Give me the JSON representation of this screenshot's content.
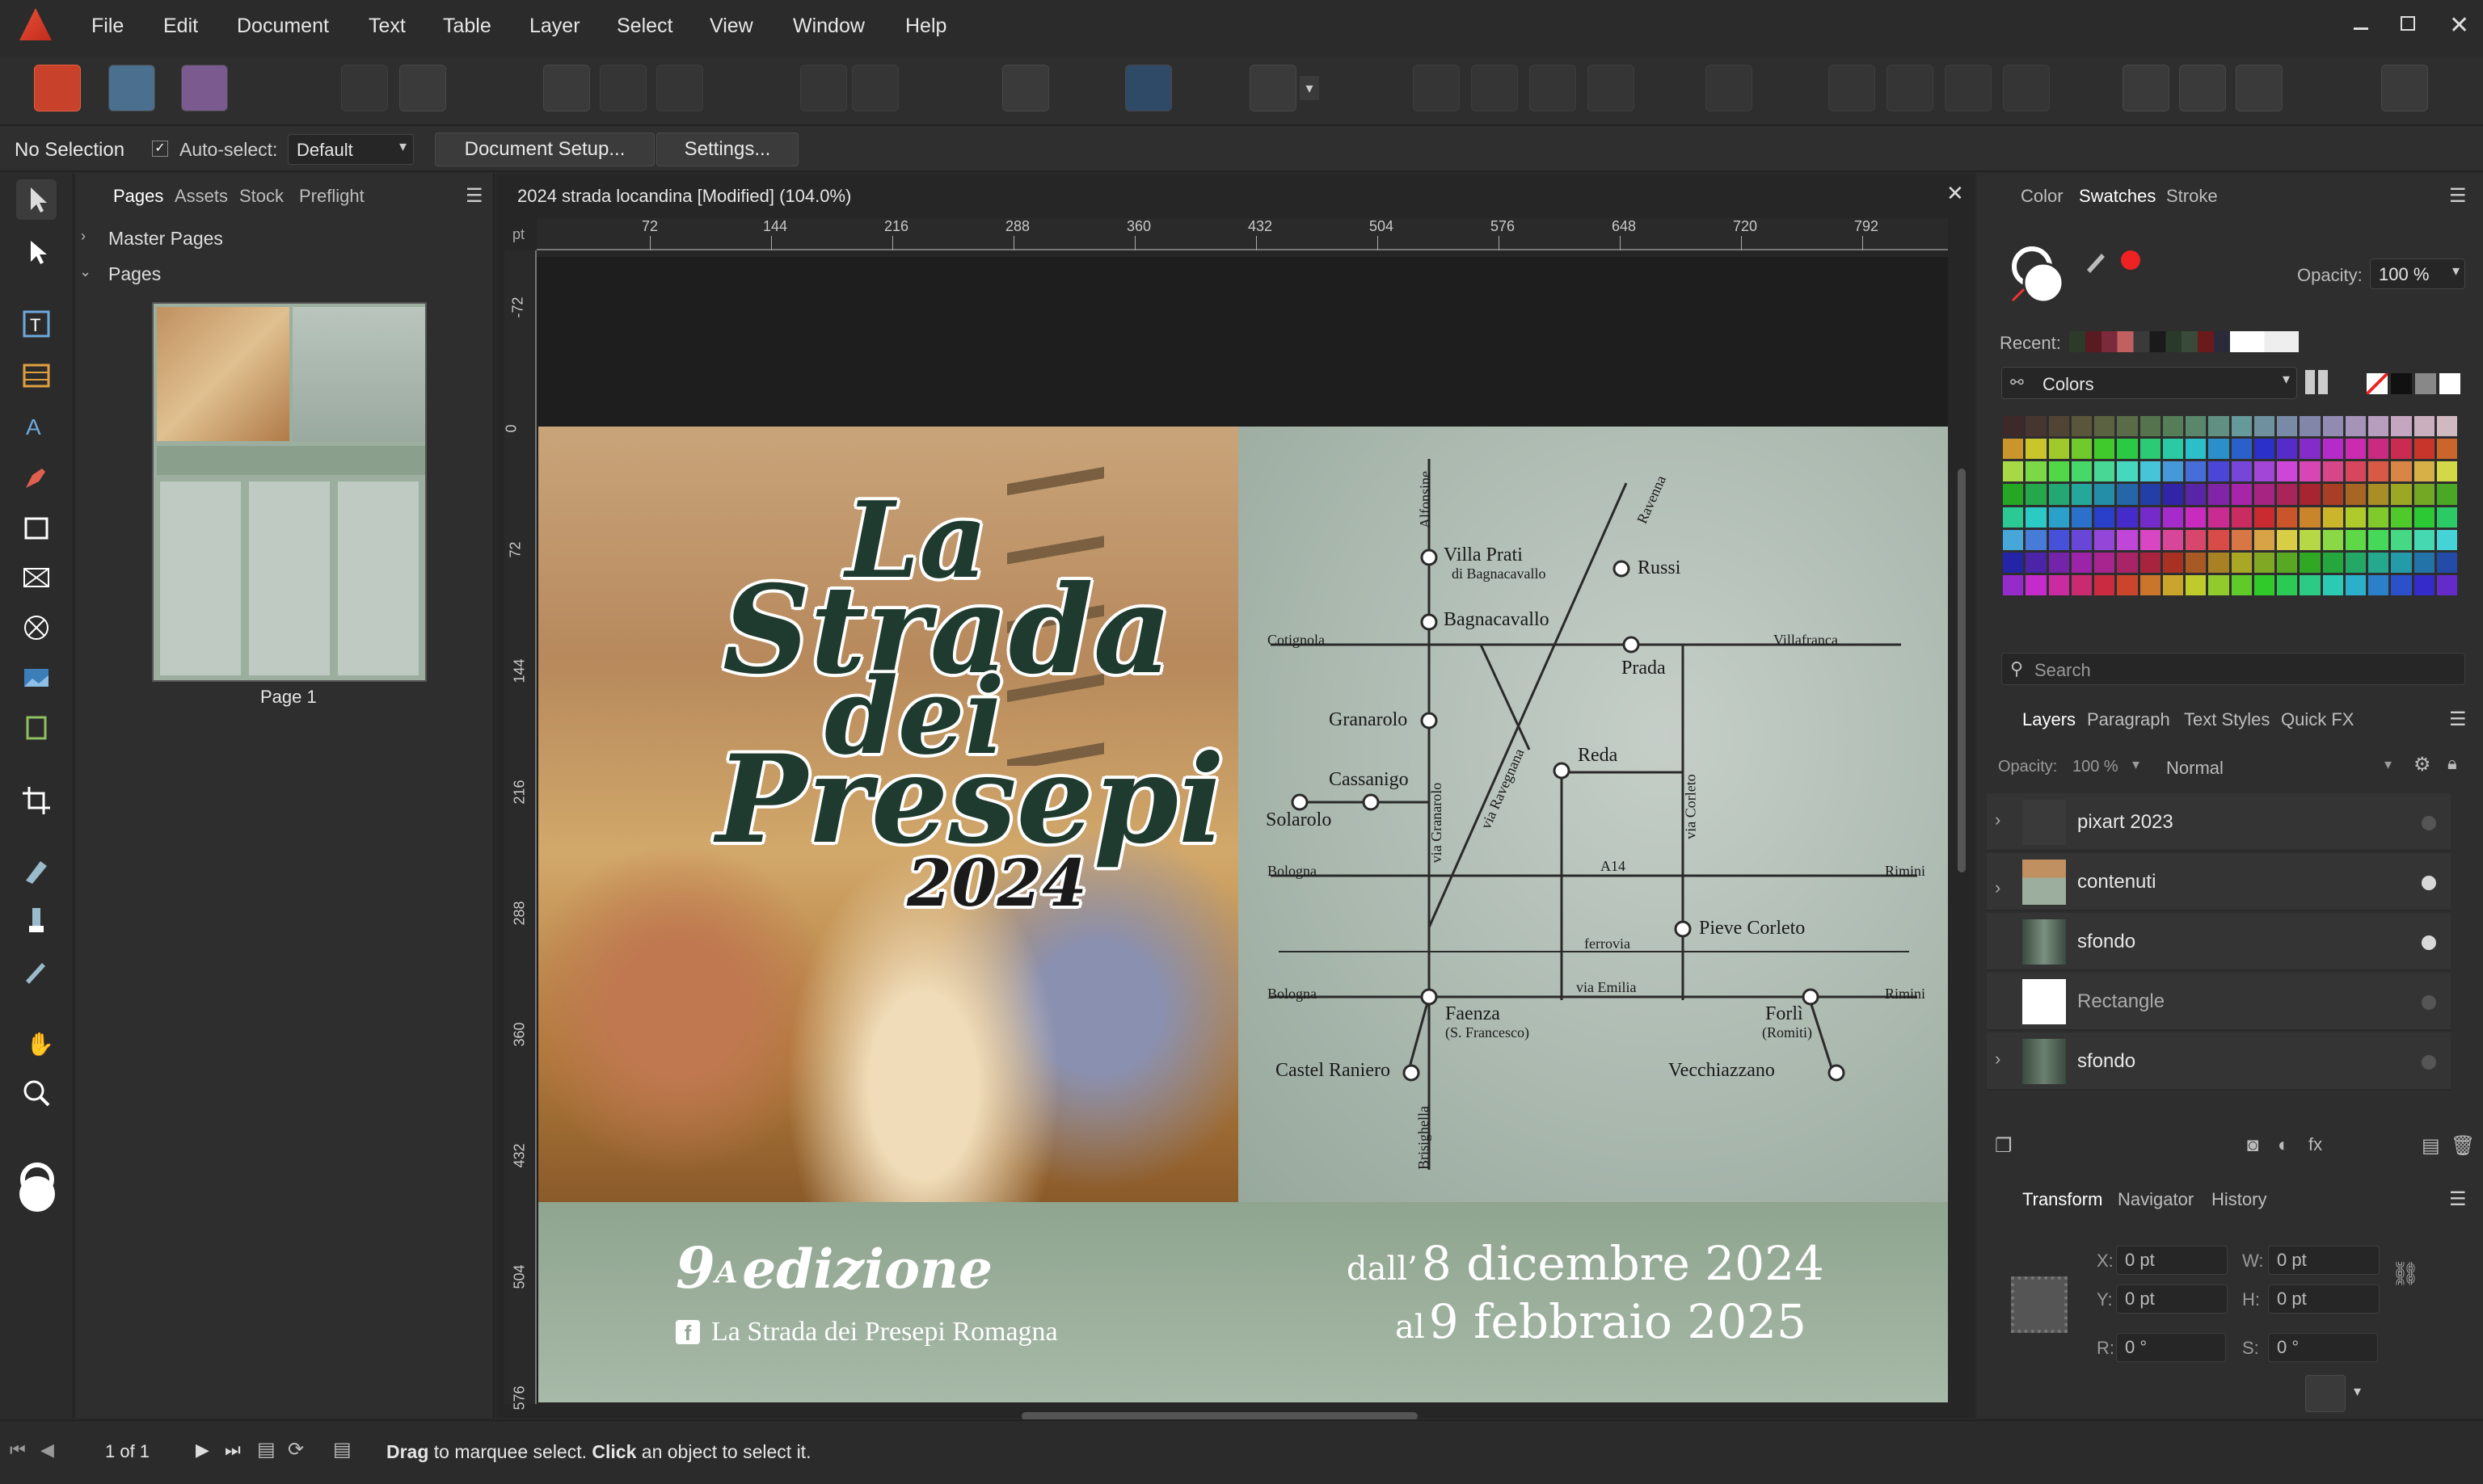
{
  "menu": [
    "File",
    "Edit",
    "Document",
    "Text",
    "Table",
    "Layer",
    "Select",
    "View",
    "Window",
    "Help"
  ],
  "context": {
    "selection": "No Selection",
    "autoselect_label": "Auto-select:",
    "autoselect_value": "Default",
    "doc_setup": "Document Setup...",
    "settings": "Settings..."
  },
  "pages_panel": {
    "tabs": [
      "Pages",
      "Assets",
      "Stock",
      "Preflight"
    ],
    "master_pages": "Master Pages",
    "pages": "Pages",
    "page_label": "Page 1"
  },
  "document": {
    "tab_title": "2024 strada locandina [Modified] (104.0%)",
    "ruler_unit": "pt",
    "h_ticks": [
      "72",
      "144",
      "216",
      "288",
      "360",
      "432",
      "504",
      "576",
      "648",
      "720",
      "792"
    ],
    "v_ticks": [
      "-72",
      "0",
      "72",
      "144",
      "216",
      "288",
      "360",
      "432",
      "504",
      "576"
    ]
  },
  "poster": {
    "title": [
      "La",
      "Strada",
      "dei",
      "Presepi"
    ],
    "year": "2024",
    "edition_num": "9",
    "edition_sup": "A",
    "edition_word": "edizione",
    "facebook": "La Strada dei Presepi Romagna",
    "date_from_prefix": "dall’",
    "date_from": "8 dicembre 2024",
    "date_to_prefix": "al",
    "date_to": "9 febbraio 2025",
    "map": {
      "towns": [
        "Villa Prati",
        "di Bagnacavallo",
        "Russi",
        "Bagnacavallo",
        "Prada",
        "Granarolo",
        "Reda",
        "Cassanigo",
        "Solarolo",
        "Pieve Corleto",
        "Faenza",
        "(S. Francesco)",
        "Forlì",
        "(Romiti)",
        "Castel Raniero",
        "Vecchiazzano"
      ],
      "roads": [
        "Alfonsine",
        "Ravenna",
        "Cotignola",
        "Villafranca",
        "via Granarolo",
        "via Ravegnana",
        "via Corleto",
        "A14",
        "Bologna",
        "Rimini",
        "ferrovia",
        "Bologna",
        "Rimini",
        "via Emilia",
        "Brisighella"
      ]
    }
  },
  "right_panel": {
    "tabs_top": [
      "Color",
      "Swatches",
      "Stroke"
    ],
    "opacity_label": "Opacity:",
    "opacity_value": "100 %",
    "recent_label": "Recent:",
    "palette": "Colors",
    "search_placeholder": "Search",
    "tabs_layers": [
      "Layers",
      "Paragraph",
      "Text Styles",
      "Quick FX"
    ],
    "layer_opacity": "100 %",
    "blend": "Normal",
    "layers": [
      "pixart 2023",
      "contenuti",
      "sfondo",
      "Rectangle",
      "sfondo"
    ],
    "tabs_transform": [
      "Transform",
      "Navigator",
      "History"
    ],
    "transform": {
      "x_label": "X:",
      "x": "0 pt",
      "y_label": "Y:",
      "y": "0 pt",
      "w_label": "W:",
      "w": "0 pt",
      "h_label": "H:",
      "h": "0 pt",
      "r_label": "R:",
      "r": "0 °",
      "s_label": "S:",
      "s": "0 °"
    }
  },
  "status": {
    "page_count": "1 of 1",
    "hint_b1": "Drag",
    "hint_t1": " to marquee select. ",
    "hint_b2": "Click",
    "hint_t2": " an object to select it."
  }
}
